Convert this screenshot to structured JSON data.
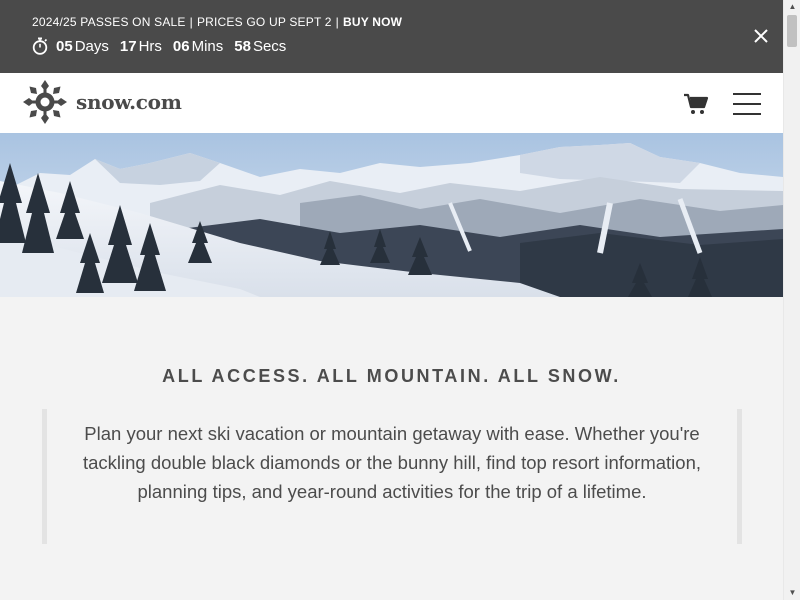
{
  "promo": {
    "message": "2024/25 PASSES ON SALE",
    "separator": "|",
    "price_notice": "PRICES GO UP SEPT 2",
    "buy_label": "BUY NOW",
    "countdown": {
      "days_value": "05",
      "days_unit": "Days",
      "hours_value": "17",
      "hours_unit": "Hrs",
      "mins_value": "06",
      "mins_unit": "Mins",
      "secs_value": "58",
      "secs_unit": "Secs"
    },
    "close_icon": "close-icon",
    "timer_icon": "stopwatch-icon"
  },
  "header": {
    "logo_text": "snow.com",
    "logo_icon": "snowflake-logo-icon",
    "cart_icon": "cart-icon",
    "menu_icon": "hamburger-menu-icon"
  },
  "hero": {
    "image": "snowy mountain panorama"
  },
  "main": {
    "tagline": "ALL ACCESS. ALL MOUNTAIN. ALL SNOW.",
    "intro": "Plan your next ski vacation or mountain getaway with ease. Whether you're tackling double black diamonds or the bunny hill, find top resort information, planning tips, and year-round activities for the trip of a lifetime."
  },
  "colors": {
    "promo_bg": "#4a4a4a",
    "header_bg": "#ffffff",
    "page_bg": "#f3f3f3",
    "text": "#4c4c4c",
    "accent_border": "#e3e3e3"
  }
}
